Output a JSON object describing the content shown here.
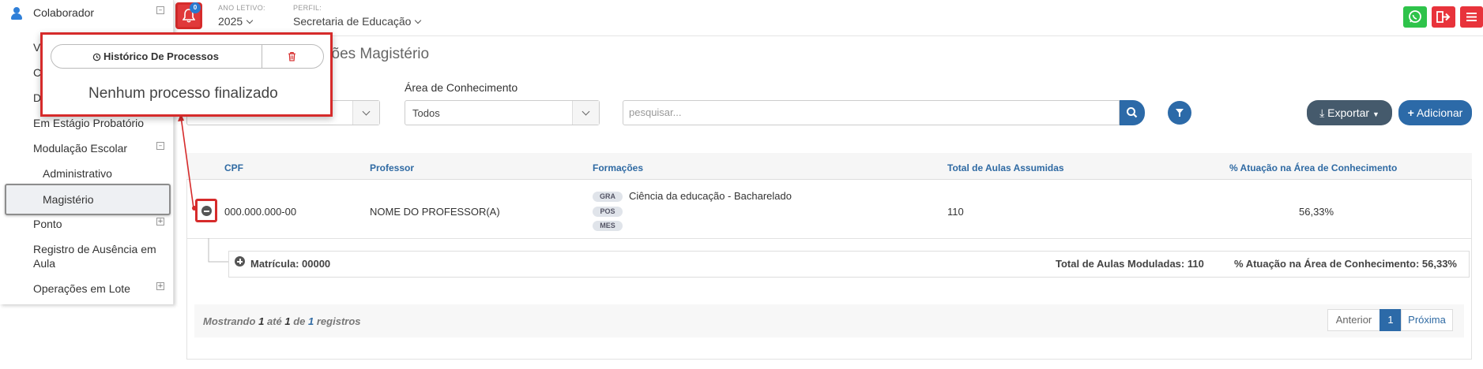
{
  "sidebar": {
    "header": "Colaborador",
    "items": [
      "Em Estágio Probatório",
      "Modulação Escolar",
      "Administrativo",
      "Magistério",
      "Ponto",
      "Registro de Ausência em",
      "Aula",
      "Operações em Lote"
    ],
    "partial": [
      "Vi",
      "C",
      "D"
    ]
  },
  "topbar": {
    "notif_count": "0",
    "ano_label": "ANO LETIVO:",
    "ano_value": "2025",
    "perfil_label": "PERFIL:",
    "perfil_value": "Secretaria de Educação"
  },
  "popup": {
    "title": "Histórico De Processos",
    "empty": "Nenhum processo finalizado"
  },
  "main": {
    "title_partial": "ções Magistério",
    "area_label": "Área de Conhecimento",
    "area_value": "Todos",
    "search_placeholder": "pesquisar...",
    "export_label": "Exportar",
    "add_label": "Adicionar"
  },
  "table": {
    "columns": [
      "CPF",
      "Professor",
      "Formações",
      "Total de Aulas Assumidas",
      "% Atuação na Área de Conhecimento"
    ],
    "row": {
      "cpf": "000.000.000-00",
      "professor": "NOME DO PROFESSOR(A)",
      "formacao": "Ciência da educação - Bacharelado",
      "tags": [
        "GRA",
        "POS",
        "MES"
      ],
      "total": "110",
      "pct": "56,33%"
    },
    "sub": {
      "matricula": "Matrícula: 00000",
      "moduladas": "Total de Aulas Moduladas: 110",
      "atuacao": "% Atuação na Área de Conhecimento: 56,33%"
    }
  },
  "footer": {
    "info_pre": "Mostrando",
    "info_a": "1",
    "info_ate": "até",
    "info_b": "1",
    "info_de": "de",
    "info_c": "1",
    "info_post": "registros",
    "prev": "Anterior",
    "page": "1",
    "next": "Próxima"
  },
  "colors": {
    "accent": "#2c6aa8",
    "danger": "#e8333b",
    "whatsapp": "#2ec34a"
  }
}
